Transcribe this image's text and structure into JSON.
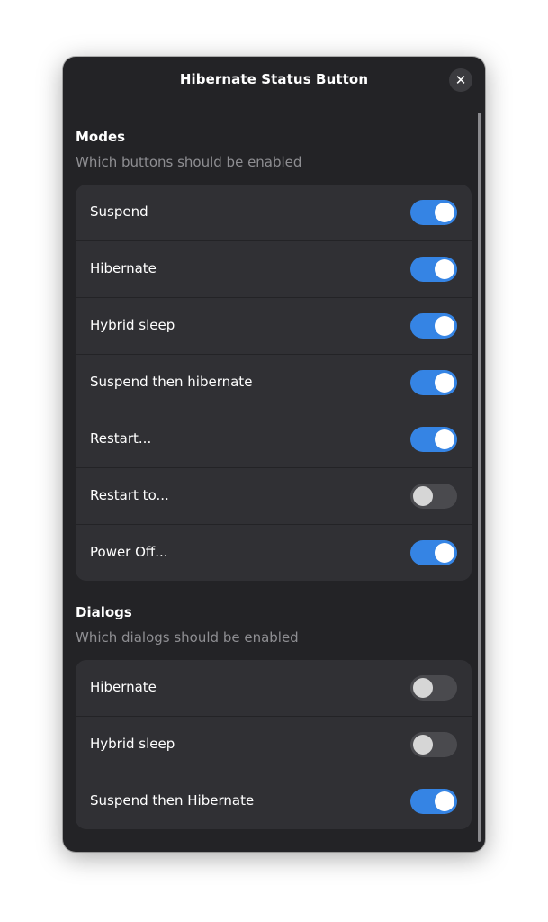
{
  "window": {
    "title": "Hibernate Status Button",
    "close_glyph": "✕"
  },
  "modes": {
    "title": "Modes",
    "subtitle": "Which buttons should be enabled",
    "items": [
      {
        "label": "Suspend",
        "enabled": true
      },
      {
        "label": "Hibernate",
        "enabled": true
      },
      {
        "label": "Hybrid sleep",
        "enabled": true
      },
      {
        "label": "Suspend then hibernate",
        "enabled": true
      },
      {
        "label": "Restart...",
        "enabled": true
      },
      {
        "label": "Restart to...",
        "enabled": false
      },
      {
        "label": "Power Off...",
        "enabled": true
      }
    ]
  },
  "dialogs": {
    "title": "Dialogs",
    "subtitle": "Which dialogs should be enabled",
    "items": [
      {
        "label": "Hibernate",
        "enabled": false
      },
      {
        "label": "Hybrid sleep",
        "enabled": false
      },
      {
        "label": "Suspend then Hibernate",
        "enabled": true
      }
    ]
  },
  "colors": {
    "accent": "#3584e4",
    "window_bg": "#232326",
    "card_bg": "#303034",
    "switch_off": "#4a4a4e",
    "subtitle": "#8e8e92"
  },
  "icons": {
    "close": "close-icon",
    "switch_knob": "switch-knob"
  }
}
